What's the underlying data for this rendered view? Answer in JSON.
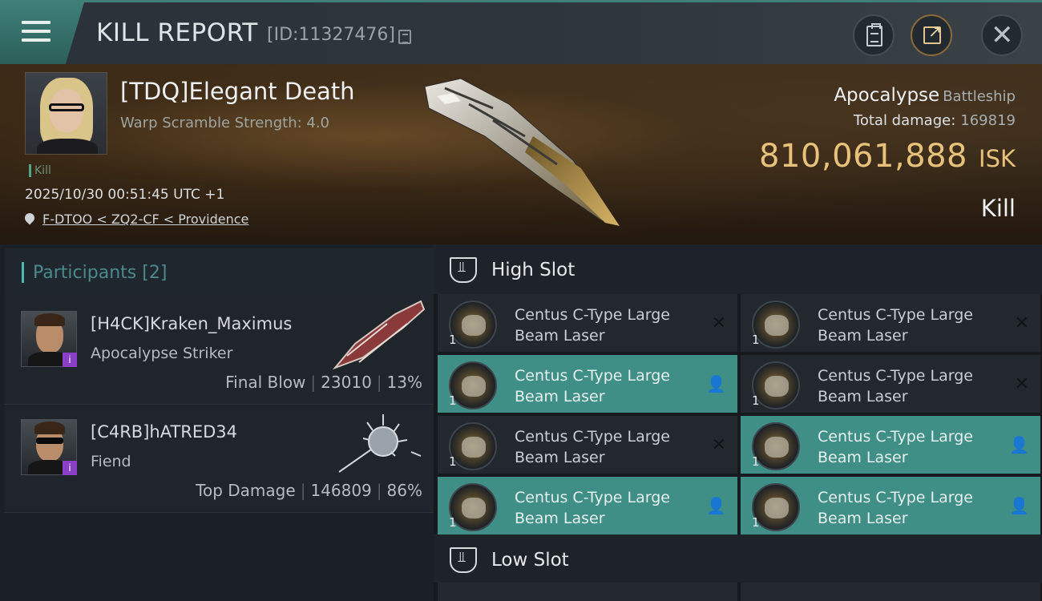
{
  "header": {
    "title": "KILL REPORT",
    "report_id": "[ID:11327476]"
  },
  "victim": {
    "name": "[TDQ]Elegant Death",
    "warp_scramble": "Warp Scramble Strength: 4.0",
    "kill_tag": "Kill",
    "timestamp": "2025/10/30 00:51:45 UTC +1",
    "location": "F-DTOO < ZQ2-CF < Providence",
    "ship_name": "Apocalypse",
    "ship_class": "Battleship",
    "total_damage_label": "Total damage:",
    "total_damage": "169819",
    "isk_value": "810,061,888",
    "isk_unit": "ISK",
    "result": "Kill"
  },
  "participants": {
    "title": "Participants",
    "count": "[2]",
    "items": [
      {
        "name": "[H4CK]Kraken_Maximus",
        "ship": "Apocalypse Striker",
        "role": "Final Blow",
        "damage": "23010",
        "percent": "13%",
        "badge": "i"
      },
      {
        "name": "[C4RB]hATRED34",
        "ship": "Fiend",
        "role": "Top Damage",
        "damage": "146809",
        "percent": "86%",
        "badge": "i"
      }
    ]
  },
  "slots": {
    "high_title": "High Slot",
    "low_title": "Low Slot",
    "high_modules": [
      {
        "qty": "1",
        "name_line1": "Centus C-Type Large",
        "name_line2": "Beam Laser",
        "status": "destroyed"
      },
      {
        "qty": "1",
        "name_line1": "Centus C-Type Large",
        "name_line2": "Beam Laser",
        "status": "destroyed"
      },
      {
        "qty": "1",
        "name_line1": "Centus C-Type Large",
        "name_line2": "Beam Laser",
        "status": "dropped"
      },
      {
        "qty": "1",
        "name_line1": "Centus C-Type Large",
        "name_line2": "Beam Laser",
        "status": "destroyed"
      },
      {
        "qty": "1",
        "name_line1": "Centus C-Type Large",
        "name_line2": "Beam Laser",
        "status": "destroyed"
      },
      {
        "qty": "1",
        "name_line1": "Centus C-Type Large",
        "name_line2": "Beam Laser",
        "status": "dropped"
      },
      {
        "qty": "1",
        "name_line1": "Centus C-Type Large",
        "name_line2": "Beam Laser",
        "status": "dropped"
      },
      {
        "qty": "1",
        "name_line1": "Centus C-Type Large",
        "name_line2": "Beam Laser",
        "status": "dropped"
      }
    ]
  },
  "colors": {
    "accent_teal": "#3f8f86",
    "isk_gold": "#e8c27a",
    "badge_purple": "#8b3fc6"
  }
}
